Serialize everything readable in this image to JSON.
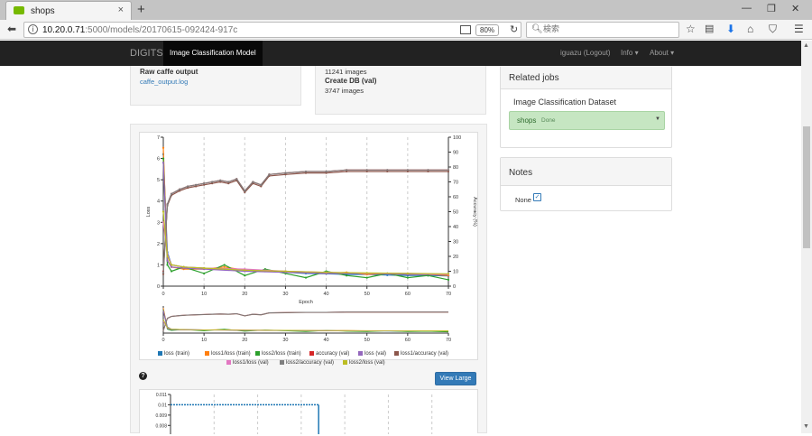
{
  "browser": {
    "tab_title": "shops",
    "tab_close": "×",
    "new_tab": "+",
    "window_min": "—",
    "window_restore": "❐",
    "window_close": "✕",
    "url_host": "10.20.0.71",
    "url_path": ":5000/models/20170615-092424-917c",
    "zoom": "80%",
    "search_placeholder": "検索"
  },
  "appnav": {
    "brand": "DIGITS",
    "active_item": "Image Classification Model",
    "user": "iguazu (Logout)",
    "info": "Info ▾",
    "about": "About ▾"
  },
  "left_info": {
    "raw_title": "Raw caffe output",
    "raw_link": "caffe_output.log"
  },
  "mid_info": {
    "train_images": "11241 images",
    "create_db_val": "Create DB (val)",
    "val_images": "3747 images"
  },
  "related": {
    "header": "Related jobs",
    "dataset_label": "Image Classification Dataset",
    "job_name": "shops",
    "job_status": "Done"
  },
  "notes": {
    "header": "Notes",
    "value": "None"
  },
  "chart_toolbar": {
    "help": "?",
    "view_large": "View Large"
  },
  "chart_data": [
    {
      "type": "line",
      "xlabel": "Epoch",
      "ylabel": "Loss",
      "y2label": "Accuracy (%)",
      "xlim": [
        0,
        70
      ],
      "ylim": [
        0,
        7
      ],
      "y2lim": [
        0,
        100
      ],
      "x_ticks": [
        "0",
        "10",
        "20",
        "30",
        "40",
        "50",
        "60",
        "70"
      ],
      "y_ticks": [
        "0",
        "1",
        "2",
        "3",
        "4",
        "5",
        "6",
        "7"
      ],
      "y2_ticks": [
        "0",
        "10",
        "20",
        "30",
        "40",
        "50",
        "60",
        "70",
        "80",
        "90",
        "100"
      ],
      "series": [
        {
          "name": "loss (train)",
          "color": "#1f77b4",
          "axis": "y",
          "x": [
            0,
            1,
            2,
            5,
            10,
            15,
            20,
            25,
            30,
            35,
            40,
            45,
            50,
            55,
            60,
            65,
            70
          ],
          "y": [
            6.2,
            1.6,
            1.0,
            0.9,
            0.85,
            0.8,
            0.75,
            0.7,
            0.65,
            0.6,
            0.58,
            0.55,
            0.55,
            0.52,
            0.5,
            0.5,
            0.48
          ]
        },
        {
          "name": "loss1/loss (train)",
          "color": "#ff7f0e",
          "axis": "y",
          "x": [
            0,
            1,
            2,
            5,
            10,
            15,
            20,
            25,
            30,
            35,
            40,
            45,
            50,
            55,
            60,
            65,
            70
          ],
          "y": [
            6.5,
            1.2,
            0.9,
            0.8,
            0.8,
            0.9,
            0.75,
            0.7,
            0.7,
            0.65,
            0.6,
            0.65,
            0.55,
            0.6,
            0.55,
            0.55,
            0.5
          ]
        },
        {
          "name": "loss2/loss (train)",
          "color": "#2ca02c",
          "axis": "y",
          "x": [
            0,
            1,
            2,
            5,
            10,
            15,
            20,
            25,
            30,
            35,
            40,
            45,
            50,
            55,
            60,
            65,
            70
          ],
          "y": [
            6.0,
            1.0,
            0.7,
            0.9,
            0.6,
            1.0,
            0.5,
            0.8,
            0.6,
            0.4,
            0.7,
            0.5,
            0.4,
            0.6,
            0.4,
            0.5,
            0.3
          ]
        },
        {
          "name": "accuracy (val)",
          "color": "#d62728",
          "axis": "y2",
          "x": [
            0,
            1,
            2,
            4,
            6,
            8,
            10,
            12,
            14,
            16,
            18,
            20,
            22,
            24,
            26,
            30,
            35,
            40,
            45,
            50,
            55,
            60,
            65,
            70
          ],
          "y": [
            10,
            55,
            62,
            65,
            67,
            68,
            69,
            70,
            71,
            70,
            72,
            64,
            70,
            68,
            75,
            76,
            77,
            77,
            78,
            78,
            78,
            78,
            78,
            78
          ]
        },
        {
          "name": "loss (val)",
          "color": "#9467bd",
          "axis": "y",
          "x": [
            0,
            1,
            2,
            5,
            10,
            20,
            30,
            40,
            50,
            60,
            70
          ],
          "y": [
            5.8,
            1.2,
            0.9,
            0.85,
            0.8,
            0.7,
            0.65,
            0.6,
            0.6,
            0.55,
            0.55
          ]
        },
        {
          "name": "loss1/accuracy (val)",
          "color": "#8c564b",
          "axis": "y2",
          "x": [
            0,
            1,
            2,
            4,
            6,
            8,
            10,
            12,
            14,
            16,
            18,
            20,
            22,
            24,
            26,
            30,
            35,
            40,
            45,
            50,
            55,
            60,
            65,
            70
          ],
          "y": [
            8,
            54,
            61,
            64,
            66,
            67,
            68,
            69,
            70,
            69,
            71,
            63,
            69,
            67,
            74,
            75,
            76,
            76,
            77,
            77,
            77,
            77,
            77,
            77
          ]
        },
        {
          "name": "loss1/loss (val)",
          "color": "#e377c2",
          "axis": "y",
          "x": [
            0,
            1,
            2,
            5,
            10,
            20,
            30,
            40,
            50,
            60,
            70
          ],
          "y": [
            3.0,
            1.5,
            1.0,
            0.9,
            0.85,
            0.8,
            0.7,
            0.65,
            0.6,
            0.6,
            0.55
          ]
        },
        {
          "name": "loss2/accuracy (val)",
          "color": "#7f7f7f",
          "axis": "y2",
          "x": [
            0,
            1,
            2,
            4,
            6,
            8,
            10,
            12,
            14,
            16,
            18,
            20,
            22,
            24,
            26,
            30,
            35,
            40,
            45,
            50,
            55,
            60,
            65,
            70
          ],
          "y": [
            9,
            55,
            62,
            65,
            67,
            68,
            69,
            70,
            71,
            70,
            72,
            64,
            70,
            68,
            75,
            76,
            77,
            77,
            78,
            78,
            78,
            78,
            78,
            78
          ]
        },
        {
          "name": "loss2/loss (val)",
          "color": "#bcbd22",
          "axis": "y",
          "x": [
            0,
            1,
            2,
            5,
            10,
            20,
            30,
            40,
            50,
            60,
            70
          ],
          "y": [
            3.5,
            1.4,
            1.0,
            0.9,
            0.85,
            0.75,
            0.7,
            0.65,
            0.62,
            0.6,
            0.58
          ]
        }
      ]
    },
    {
      "type": "line",
      "title": "",
      "xlabel": "",
      "ylabel": "",
      "x_ticks": [],
      "y_ticks": [
        "0.011",
        "0.01",
        "0.009",
        "0.008"
      ],
      "ylim": [
        0.0075,
        0.011
      ],
      "series": [
        {
          "name": "",
          "color": "#1f77b4",
          "x": [
            0,
            10,
            20,
            30,
            34
          ],
          "y": [
            0.01,
            0.01,
            0.01,
            0.01,
            0.01
          ]
        }
      ]
    }
  ]
}
